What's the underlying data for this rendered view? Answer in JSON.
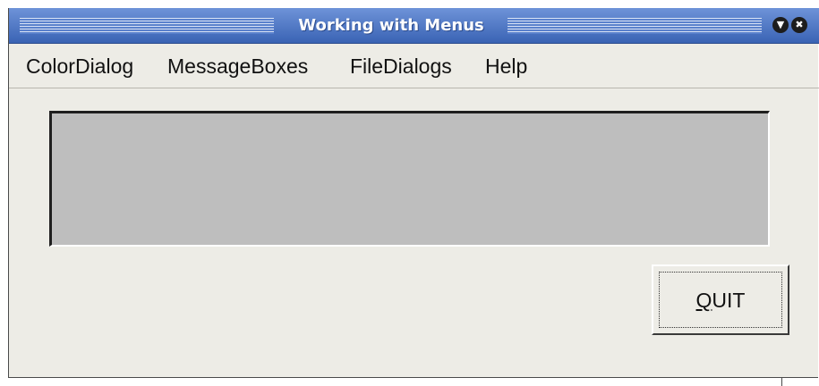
{
  "window": {
    "title": "Working with Menus",
    "minimize_icon": "chevron-down-icon",
    "close_icon": "close-icon"
  },
  "menubar": {
    "items": [
      {
        "label": "ColorDialog"
      },
      {
        "label": "MessageBoxes"
      },
      {
        "label": "FileDialogs"
      },
      {
        "label": "Help"
      }
    ]
  },
  "display": {
    "text": ""
  },
  "quit_button": {
    "label": "QUIT"
  },
  "colors": {
    "titlebar": "#3a63b4",
    "background": "#edece6",
    "display": "#bebebe"
  }
}
